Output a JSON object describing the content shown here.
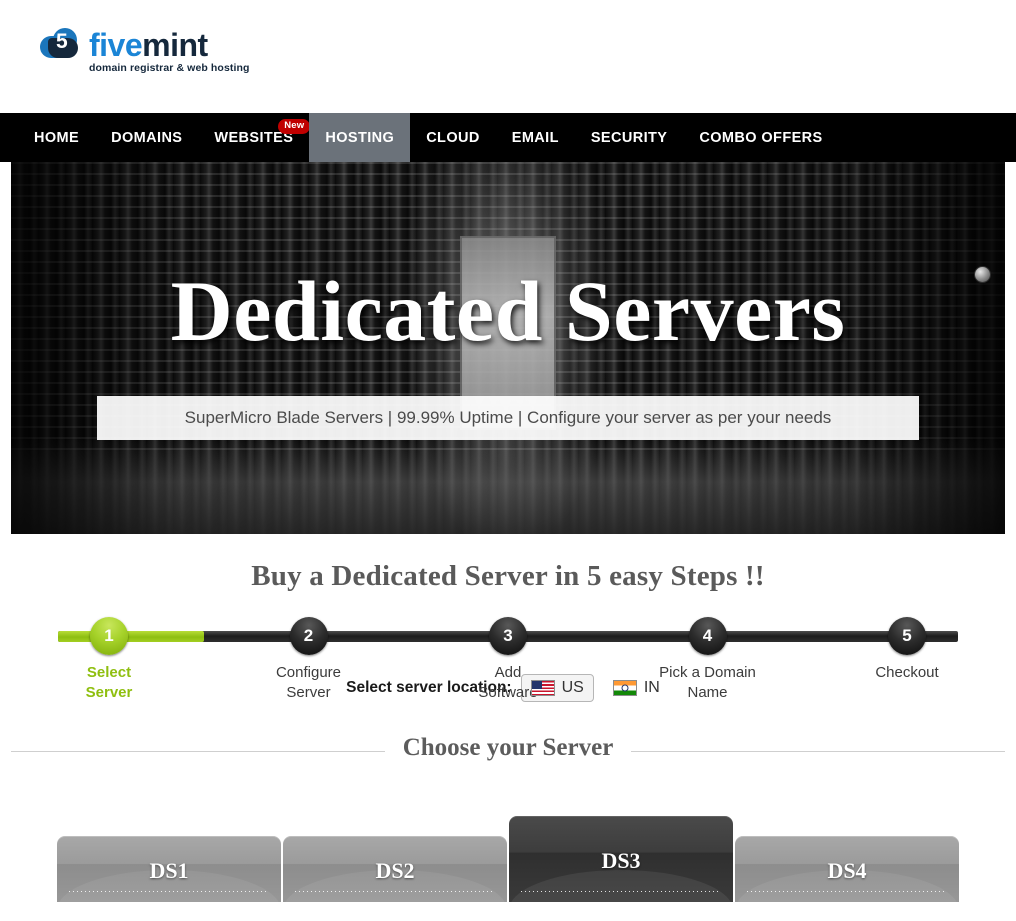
{
  "brand": {
    "logo_icon": "cloud-five-logo-icon",
    "name_part1": "five",
    "name_part2": "mint",
    "tagline": "domain registrar & web hosting",
    "mark_digit": "5",
    "colors": {
      "blue": "#1b85d6",
      "dark": "#15283c"
    }
  },
  "nav": {
    "items": [
      {
        "label": "HOME",
        "active": false,
        "badge": ""
      },
      {
        "label": "DOMAINS",
        "active": false,
        "badge": ""
      },
      {
        "label": "WEBSITES",
        "active": false,
        "badge": "New"
      },
      {
        "label": "HOSTING",
        "active": true,
        "badge": ""
      },
      {
        "label": "CLOUD",
        "active": false,
        "badge": ""
      },
      {
        "label": "EMAIL",
        "active": false,
        "badge": ""
      },
      {
        "label": "SECURITY",
        "active": false,
        "badge": ""
      },
      {
        "label": "COMBO OFFERS",
        "active": false,
        "badge": ""
      }
    ],
    "active_bg": "#6b727a",
    "badge_bg": "#c00000"
  },
  "hero": {
    "title": "Dedicated Servers",
    "subtitle": "SuperMicro Blade Servers | 99.99% Uptime | Configure your server as per your needs",
    "background_image": "datacenter-server-racks-photo"
  },
  "steps_section": {
    "heading": "Buy a Dedicated Server in 5 easy Steps !!",
    "active_color": "#8fbf10",
    "progress_percent": 12,
    "steps": [
      {
        "number": "1",
        "label": "Select\nServer",
        "line1": "Select",
        "line2": "Server",
        "active": true
      },
      {
        "number": "2",
        "label": "Configure\nServer",
        "line1": "Configure",
        "line2": "Server",
        "active": false
      },
      {
        "number": "3",
        "label": "Add\nSoftware",
        "line1": "Add",
        "line2": "Software",
        "active": false
      },
      {
        "number": "4",
        "label": "Pick a Domain\nName",
        "line1": "Pick a Domain",
        "line2": "Name",
        "active": false
      },
      {
        "number": "5",
        "label": "Checkout",
        "line1": "Checkout",
        "line2": "",
        "active": false
      }
    ]
  },
  "location": {
    "label": "Select server location:",
    "options": [
      {
        "code": "US",
        "flag_icon": "flag-us-icon",
        "selected": true
      },
      {
        "code": "IN",
        "flag_icon": "flag-in-icon",
        "selected": false
      }
    ]
  },
  "choose_server": {
    "title": "Choose your Server",
    "tabs": [
      {
        "label": "DS1",
        "active": false
      },
      {
        "label": "DS2",
        "active": false
      },
      {
        "label": "DS3",
        "active": true
      },
      {
        "label": "DS4",
        "active": false
      }
    ]
  }
}
